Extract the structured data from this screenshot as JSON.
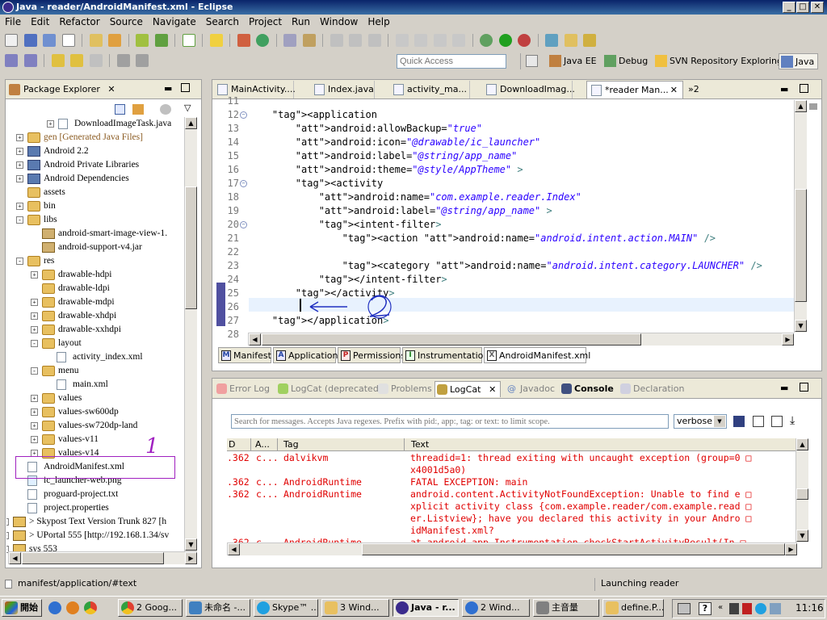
{
  "window": {
    "title": "Java - reader/AndroidManifest.xml - Eclipse",
    "min": "_",
    "max": "□",
    "close": "✕"
  },
  "menu": [
    "File",
    "Edit",
    "Refactor",
    "Source",
    "Navigate",
    "Search",
    "Project",
    "Run",
    "Window",
    "Help"
  ],
  "quick_access": {
    "placeholder": "Quick Access"
  },
  "perspectives": [
    {
      "label": "Java EE"
    },
    {
      "label": "Debug"
    },
    {
      "label": "SVN Repository Exploring"
    },
    {
      "label": "Java"
    }
  ],
  "package_explorer": {
    "tab": "Package Explorer",
    "items": [
      {
        "text": "DownloadImageTask.java",
        "exp": "+"
      },
      {
        "text": "gen [Generated Java Files]",
        "exp": "+"
      },
      {
        "text": "Android 2.2",
        "exp": "+"
      },
      {
        "text": "Android Private Libraries",
        "exp": "+"
      },
      {
        "text": "Android Dependencies",
        "exp": "+"
      },
      {
        "text": "assets",
        "exp": ""
      },
      {
        "text": "bin",
        "exp": "+"
      },
      {
        "text": "libs",
        "exp": "-"
      },
      {
        "text": "android-smart-image-view-1.",
        "exp": ""
      },
      {
        "text": "android-support-v4.jar",
        "exp": ""
      },
      {
        "text": "res",
        "exp": "-"
      },
      {
        "text": "drawable-hdpi",
        "exp": "+"
      },
      {
        "text": "drawable-ldpi",
        "exp": ""
      },
      {
        "text": "drawable-mdpi",
        "exp": "+"
      },
      {
        "text": "drawable-xhdpi",
        "exp": "+"
      },
      {
        "text": "drawable-xxhdpi",
        "exp": "+"
      },
      {
        "text": "layout",
        "exp": "-"
      },
      {
        "text": "activity_index.xml",
        "exp": ""
      },
      {
        "text": "menu",
        "exp": "-"
      },
      {
        "text": "main.xml",
        "exp": ""
      },
      {
        "text": "values",
        "exp": "+"
      },
      {
        "text": "values-sw600dp",
        "exp": "+"
      },
      {
        "text": "values-sw720dp-land",
        "exp": "+"
      },
      {
        "text": "values-v11",
        "exp": "+"
      },
      {
        "text": "values-v14",
        "exp": "+"
      },
      {
        "text": "AndroidManifest.xml",
        "exp": ""
      },
      {
        "text": "ic_launcher-web.png",
        "exp": ""
      },
      {
        "text": "proguard-project.txt",
        "exp": ""
      },
      {
        "text": "project.properties",
        "exp": ""
      },
      {
        "text": "> Skypost Text Version Trunk 827 [h",
        "exp": "+"
      },
      {
        "text": "> UPortal 555 [http://192.168.1.34/sv",
        "exp": "+"
      },
      {
        "text": "sys 553",
        "exp": "+"
      }
    ]
  },
  "editor_tabs": [
    "MainActivity....",
    "Index.java",
    "activity_ma...",
    "DownloadImag...",
    "*reader Man...",
    "»2"
  ],
  "code": {
    "line_numbers": [
      "11",
      "12",
      "13",
      "14",
      "15",
      "16",
      "17",
      "18",
      "19",
      "20",
      "21",
      "22",
      "23",
      "24",
      "25",
      "26",
      "27",
      "28"
    ],
    "lines": [
      "",
      "    <application",
      "        android:allowBackup=\"true\"",
      "        android:icon=\"@drawable/ic_launcher\"",
      "        android:label=\"@string/app_name\"",
      "        android:theme=\"@style/AppTheme\" >",
      "        <activity",
      "            android:name=\"com.example.reader.Index\"",
      "            android:label=\"@string/app_name\" >",
      "            <intent-filter>",
      "                <action android:name=\"android.intent.action.MAIN\" />",
      "",
      "                <category android:name=\"android.intent.category.LAUNCHER\" />",
      "            </intent-filter>",
      "        </activity>",
      "        ",
      "    </application>",
      ""
    ]
  },
  "manifest_tabs": [
    "Manifest",
    "Application",
    "Permissions",
    "Instrumentation",
    "AndroidManifest.xml"
  ],
  "bottom_tabs": [
    "Error Log",
    "LogCat (deprecated)",
    "Problems",
    "LogCat",
    "Javadoc",
    "Console",
    "Declaration"
  ],
  "logcat": {
    "search_placeholder": "Search for messages. Accepts Java regexes. Prefix with pid:, app:, tag: or text: to limit scope.",
    "level": "verbose",
    "columns": [
      "D",
      "A...",
      "Tag",
      "Text"
    ],
    "rows": [
      {
        "time": ".362",
        "app": "c...",
        "tag": "dalvikvm",
        "text": "threadid=1: thread exiting with uncaught exception (group=0 □"
      },
      {
        "time": "",
        "app": "",
        "tag": "",
        "text": "x4001d5a0)"
      },
      {
        "time": ".362",
        "app": "c...",
        "tag": "AndroidRuntime",
        "text": "FATAL EXCEPTION: main"
      },
      {
        "time": ".362",
        "app": "c...",
        "tag": "AndroidRuntime",
        "text": "android.content.ActivityNotFoundException: Unable to find e □"
      },
      {
        "time": "",
        "app": "",
        "tag": "",
        "text": "xplicit activity class {com.example.reader/com.example.read □"
      },
      {
        "time": "",
        "app": "",
        "tag": "",
        "text": "er.Listview}; have you declared this activity in your Andro □"
      },
      {
        "time": "",
        "app": "",
        "tag": "",
        "text": "idManifest.xml?"
      },
      {
        "time": ".362",
        "app": "c...",
        "tag": "AndroidRuntime",
        "text": "at android.app.Instrumentation.checkStartActivityResult(In □"
      }
    ]
  },
  "status": {
    "left": "manifest/application/#text",
    "right": "Launching reader"
  },
  "taskbar": {
    "start": "開始",
    "tasks": [
      "2 Goog...",
      "未命名 -...",
      "Skype™ ...",
      "3 Wind...",
      "Java - r...",
      "2 Wind...",
      "主音量",
      "define.P..."
    ],
    "clock": "11:16"
  },
  "annotations": {
    "one": "1",
    "two": "2"
  }
}
